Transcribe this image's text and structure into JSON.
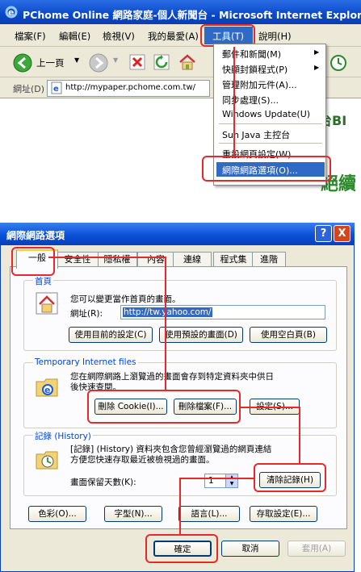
{
  "ie": {
    "title": "PChome Online 網路家庭-個人新聞台 - Microsoft Internet Explorer",
    "menus": [
      "檔案(F)",
      "編輯(E)",
      "檢視(V)",
      "我的最愛(A)",
      "工具(T)",
      "說明(H)"
    ],
    "back_label": "上一頁",
    "address_label": "網址(D)",
    "address_value": "http://mypaper.pchome.com.tw/",
    "page_snippet": "台BI",
    "page_snippet2": "絕續",
    "tools_menu": {
      "items": [
        "郵件和新聞(M)",
        "快顯封鎖程式(P)",
        "管理附加元件(A)...",
        "同步處理(S)...",
        "Windows Update(U)",
        "Sun Java 主控台",
        "重設網頁設定(W)...",
        "網際網路選項(O)..."
      ],
      "selected": "網際網路選項(O)..."
    }
  },
  "dialog": {
    "title": "網際網路選項",
    "tabs": [
      "一般",
      "安全性",
      "隱私權",
      "內容",
      "連線",
      "程式集",
      "進階"
    ],
    "active_tab": "一般",
    "home": {
      "group_label": "首頁",
      "desc": "您可以變更當作首頁的畫面。",
      "address_label": "網址(R):",
      "address_value": "http://tw.yahoo.com/",
      "btn_current": "使用目前的設定(C)",
      "btn_default": "使用預設的畫面(D)",
      "btn_blank": "使用空白頁(B)"
    },
    "temp_files": {
      "group_label": "Temporary Internet files",
      "desc_line1": "您在網際網路上瀏覽過的畫面會存到特定資料夾中供日",
      "desc_line2": "後快速查閱。",
      "btn_cookies": "刪除 Cookie(I)...",
      "btn_files": "刪除檔案(F)...",
      "btn_settings": "設定(S)..."
    },
    "history": {
      "group_label": "記錄 (History)",
      "desc_line1": "[記錄] (History) 資料夾包含您曾經瀏覽過的網頁連結",
      "desc_line2": "方便您快速存取最近被檢視過的畫面。",
      "days_label": "畫面保留天數(K):",
      "days_value": "1",
      "btn_clear": "清除記錄(H)"
    },
    "bottom_buttons": [
      "色彩(O)...",
      "字型(N)...",
      "語言(L)...",
      "存取設定(E)..."
    ],
    "ok": "確定",
    "cancel": "取消",
    "apply": "套用(A)",
    "help_btn": "?",
    "close_btn": "X"
  },
  "colors": {
    "annotation_red": "#e52a2a",
    "xp_blue": "#0a48c8",
    "dialog_bg": "#ece9d8"
  }
}
